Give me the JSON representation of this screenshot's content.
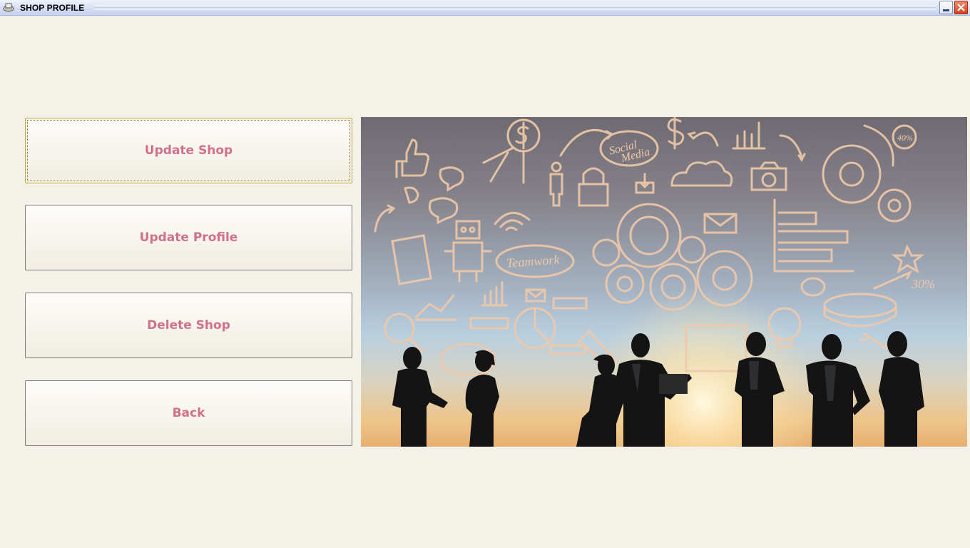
{
  "window": {
    "title": "SHOP PROFILE",
    "icon": "app-icon",
    "controls": [
      "minimize-icon",
      "close-icon"
    ]
  },
  "buttons": {
    "update_shop": "Update Shop",
    "update_profile": "Update Profile",
    "delete_shop": "Delete Shop",
    "back": "Back"
  },
  "banner": {
    "doodle_texts": [
      "Social Media",
      "Teamwork",
      "40%",
      "30%",
      "$"
    ],
    "colors": {
      "label": "#d0708d",
      "sky_top": "#6e6a72",
      "sky_bottom": "#e7b070"
    }
  }
}
